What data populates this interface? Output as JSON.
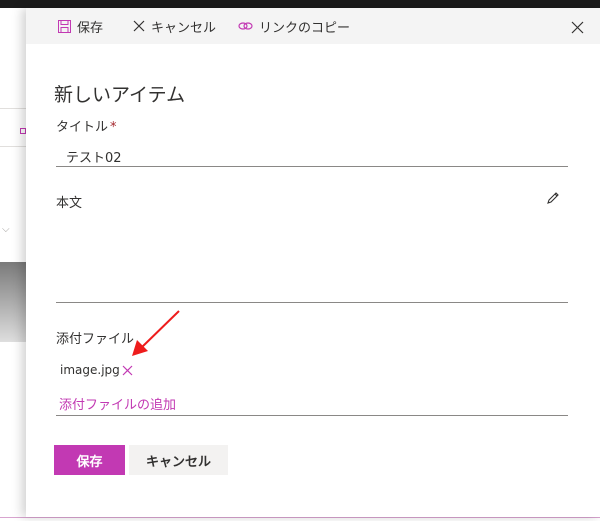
{
  "toolbar": {
    "save_label": "保存",
    "cancel_label": "キャンセル",
    "copy_link_label": "リンクのコピー"
  },
  "form": {
    "heading": "新しいアイテム",
    "title_label": "タイトル",
    "required_marker": "*",
    "title_value": "テスト02",
    "body_label": "本文",
    "attachments_label": "添付ファイル",
    "attachment_file": "image.jpg",
    "add_attachment_label": "添付ファイルの追加"
  },
  "footer": {
    "save_label": "保存",
    "cancel_label": "キャンセル"
  },
  "colors": {
    "accent": "#c239b3",
    "annotation_arrow": "#ee1c1c",
    "command_bar": "#f4f4f4"
  },
  "icons": [
    "save-icon",
    "cancel-icon",
    "link-icon",
    "close-icon",
    "pencil-icon",
    "remove-attachment-icon"
  ]
}
